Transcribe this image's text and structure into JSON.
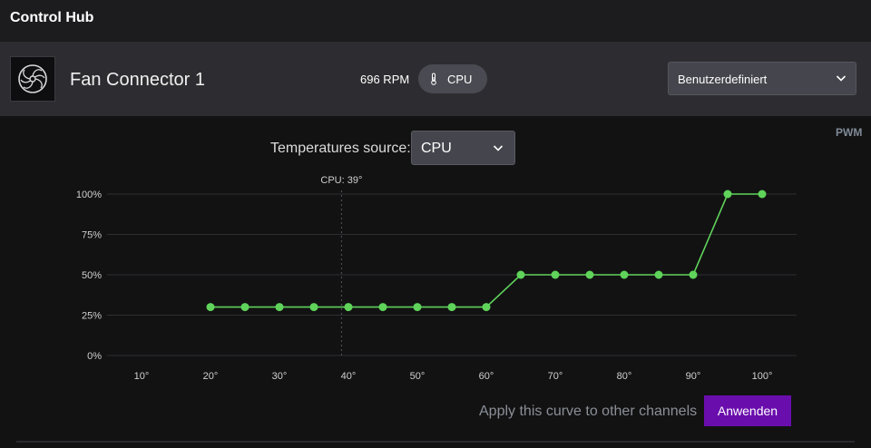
{
  "app": {
    "title": "Control Hub"
  },
  "fan": {
    "name": "Fan Connector 1",
    "rpm": "696 RPM",
    "source_pill": "CPU",
    "mode": "Benutzerdefiniert"
  },
  "controls": {
    "pwm_label": "PWM",
    "temp_source_label": "Temperatures source:",
    "temp_source_value": "CPU",
    "apply_label": "Apply this curve to other channels",
    "apply_button": "Anwenden"
  },
  "icons": {
    "fan": "fan-icon",
    "thermometer": "thermometer-icon",
    "chevron": "chevron-down-icon"
  },
  "colors": {
    "curve": "#5fd35a",
    "accent_button": "#6a0dad"
  },
  "chart_data": {
    "type": "line",
    "x_tick_labels": [
      "10°",
      "20°",
      "30°",
      "40°",
      "50°",
      "60°",
      "70°",
      "80°",
      "90°",
      "100°"
    ],
    "y_tick_labels": [
      "0%",
      "25%",
      "50%",
      "75%",
      "100%"
    ],
    "x_ticks": [
      10,
      20,
      30,
      40,
      50,
      60,
      70,
      80,
      90,
      100
    ],
    "y_ticks": [
      0,
      25,
      50,
      75,
      100
    ],
    "xlim": [
      5,
      105
    ],
    "ylim": [
      0,
      100
    ],
    "grid": true,
    "marker": {
      "x": 39,
      "label": "CPU: 39°"
    },
    "series": [
      {
        "x": [
          20,
          25,
          30,
          35,
          40,
          45,
          50,
          55,
          60,
          65,
          70,
          75,
          80,
          85,
          90,
          95,
          100
        ],
        "values": [
          30,
          30,
          30,
          30,
          30,
          30,
          30,
          30,
          30,
          50,
          50,
          50,
          50,
          50,
          50,
          100,
          100
        ]
      }
    ]
  }
}
